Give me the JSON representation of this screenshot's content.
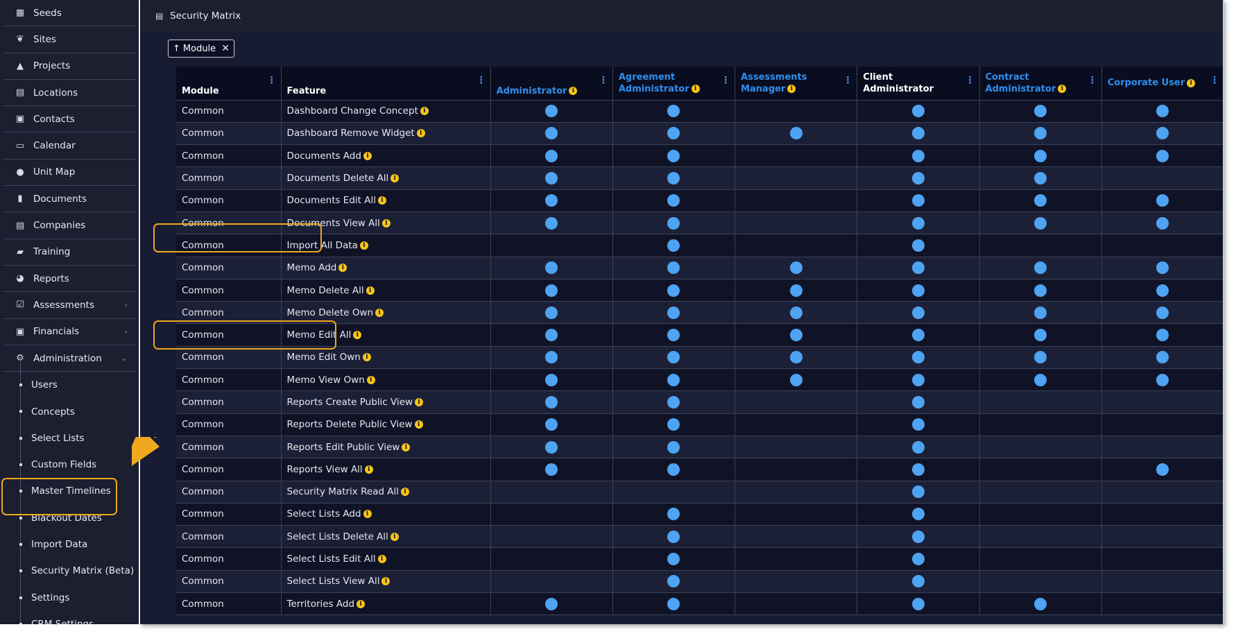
{
  "sidebar": {
    "items": [
      {
        "label": "Seeds",
        "icon": "grid-icon",
        "glyph": "▦"
      },
      {
        "label": "Sites",
        "icon": "leaf-icon",
        "glyph": "❦"
      },
      {
        "label": "Projects",
        "icon": "road-icon",
        "glyph": "▲"
      },
      {
        "label": "Locations",
        "icon": "building-icon",
        "glyph": "▤"
      },
      {
        "label": "Contacts",
        "icon": "address-book-icon",
        "glyph": "▣"
      },
      {
        "label": "Calendar",
        "icon": "calendar-icon",
        "glyph": "▭"
      },
      {
        "label": "Unit Map",
        "icon": "globe-icon",
        "glyph": "●"
      },
      {
        "label": "Documents",
        "icon": "document-icon",
        "glyph": "▮"
      },
      {
        "label": "Companies",
        "icon": "building-icon",
        "glyph": "▤"
      },
      {
        "label": "Training",
        "icon": "graduation-cap-icon",
        "glyph": "▰"
      },
      {
        "label": "Reports",
        "icon": "pie-chart-icon",
        "glyph": "◕"
      },
      {
        "label": "Assessments",
        "icon": "checkbox-icon",
        "glyph": "☑",
        "chevron": "›"
      },
      {
        "label": "Financials",
        "icon": "money-icon",
        "glyph": "▣",
        "chevron": "›"
      },
      {
        "label": "Administration",
        "icon": "cogs-icon",
        "glyph": "⚙",
        "chevron": "⌄"
      }
    ],
    "sub_items": [
      "Users",
      "Concepts",
      "Select Lists",
      "Custom Fields",
      "Master Timelines",
      "Blackout Dates",
      "Import Data",
      "Security Matrix (Beta)",
      "Settings",
      "CRM Settings"
    ]
  },
  "header": {
    "title": "Security Matrix",
    "icon": "building-icon",
    "glyph": "▤"
  },
  "group_chip": {
    "arrow": "↑",
    "label": "Module",
    "close": "✕"
  },
  "grid": {
    "columns": [
      {
        "label": "Module",
        "style": "white"
      },
      {
        "label": "Feature",
        "style": "white"
      },
      {
        "label": "Administrator",
        "style": "blue",
        "info": true
      },
      {
        "label": "Agreement Administrator",
        "style": "blue",
        "info": true
      },
      {
        "label": "Assessments Manager",
        "style": "blue",
        "info": true
      },
      {
        "label": "Client Administrator",
        "style": "white"
      },
      {
        "label": "Contract Administrator",
        "style": "blue",
        "info": true
      },
      {
        "label": "Corporate User",
        "style": "blue",
        "info": true
      }
    ],
    "menu_glyph": "⋮",
    "info_glyph": "i",
    "rows": [
      {
        "module": "Common",
        "feature": "Dashboard Change Concept",
        "perms": [
          1,
          1,
          0,
          1,
          1,
          1
        ]
      },
      {
        "module": "Common",
        "feature": "Dashboard Remove Widget",
        "perms": [
          1,
          1,
          1,
          1,
          1,
          1
        ]
      },
      {
        "module": "Common",
        "feature": "Documents Add",
        "perms": [
          1,
          1,
          0,
          1,
          1,
          1
        ]
      },
      {
        "module": "Common",
        "feature": "Documents Delete All",
        "perms": [
          1,
          1,
          0,
          1,
          1,
          0
        ]
      },
      {
        "module": "Common",
        "feature": "Documents Edit All",
        "perms": [
          1,
          1,
          0,
          1,
          1,
          1
        ]
      },
      {
        "module": "Common",
        "feature": "Documents View All",
        "perms": [
          1,
          1,
          0,
          1,
          1,
          1
        ]
      },
      {
        "module": "Common",
        "feature": "Import All Data",
        "perms": [
          0,
          1,
          0,
          1,
          0,
          0
        ]
      },
      {
        "module": "Common",
        "feature": "Memo Add",
        "perms": [
          1,
          1,
          1,
          1,
          1,
          1
        ]
      },
      {
        "module": "Common",
        "feature": "Memo Delete All",
        "perms": [
          1,
          1,
          1,
          1,
          1,
          1
        ]
      },
      {
        "module": "Common",
        "feature": "Memo Delete Own",
        "perms": [
          1,
          1,
          1,
          1,
          1,
          1
        ]
      },
      {
        "module": "Common",
        "feature": "Memo Edit All",
        "perms": [
          1,
          1,
          1,
          1,
          1,
          1
        ]
      },
      {
        "module": "Common",
        "feature": "Memo Edit Own",
        "perms": [
          1,
          1,
          1,
          1,
          1,
          1
        ]
      },
      {
        "module": "Common",
        "feature": "Memo View Own",
        "perms": [
          1,
          1,
          1,
          1,
          1,
          1
        ]
      },
      {
        "module": "Common",
        "feature": "Reports Create Public View",
        "perms": [
          1,
          1,
          0,
          1,
          0,
          0
        ]
      },
      {
        "module": "Common",
        "feature": "Reports Delete Public View",
        "perms": [
          1,
          1,
          0,
          1,
          0,
          0
        ]
      },
      {
        "module": "Common",
        "feature": "Reports Edit Public View",
        "perms": [
          1,
          1,
          0,
          1,
          0,
          0
        ]
      },
      {
        "module": "Common",
        "feature": "Reports View All",
        "perms": [
          1,
          1,
          0,
          1,
          0,
          1
        ]
      },
      {
        "module": "Common",
        "feature": "Security Matrix Read All",
        "perms": [
          0,
          0,
          0,
          1,
          0,
          0
        ]
      },
      {
        "module": "Common",
        "feature": "Select Lists Add",
        "perms": [
          0,
          1,
          0,
          1,
          0,
          0
        ]
      },
      {
        "module": "Common",
        "feature": "Select Lists Delete All",
        "perms": [
          0,
          1,
          0,
          1,
          0,
          0
        ]
      },
      {
        "module": "Common",
        "feature": "Select Lists Edit All",
        "perms": [
          0,
          1,
          0,
          1,
          0,
          0
        ]
      },
      {
        "module": "Common",
        "feature": "Select Lists View All",
        "perms": [
          0,
          1,
          0,
          1,
          0,
          0
        ]
      },
      {
        "module": "Common",
        "feature": "Territories Add",
        "perms": [
          1,
          1,
          0,
          1,
          1,
          0
        ]
      }
    ]
  },
  "colors": {
    "highlight": "#f0a81e",
    "accent_blue": "#2f8ff0",
    "dot_blue": "#4ea3f2",
    "info_yellow": "#f5c518"
  }
}
